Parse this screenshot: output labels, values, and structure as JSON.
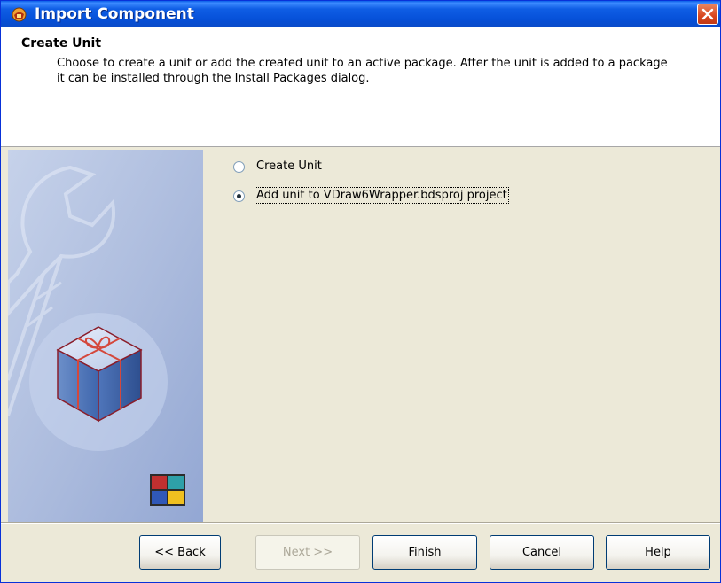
{
  "window": {
    "title": "Import Component"
  },
  "header": {
    "title": "Create Unit",
    "description": "Choose to create a unit or add the created unit to an active package. After the unit is added to a package it can be installed through the Install Packages dialog."
  },
  "options": [
    {
      "label": "Create Unit",
      "checked": false
    },
    {
      "label": "Add unit to VDraw6Wrapper.bdsproj project",
      "checked": true
    }
  ],
  "buttons": {
    "back": "<< Back",
    "next": "Next >>",
    "finish": "Finish",
    "cancel": "Cancel",
    "help": "Help"
  },
  "colors": {
    "titlebar": "#0650d8",
    "dialog_bg": "#ece9d8",
    "close": "#d8461f"
  }
}
